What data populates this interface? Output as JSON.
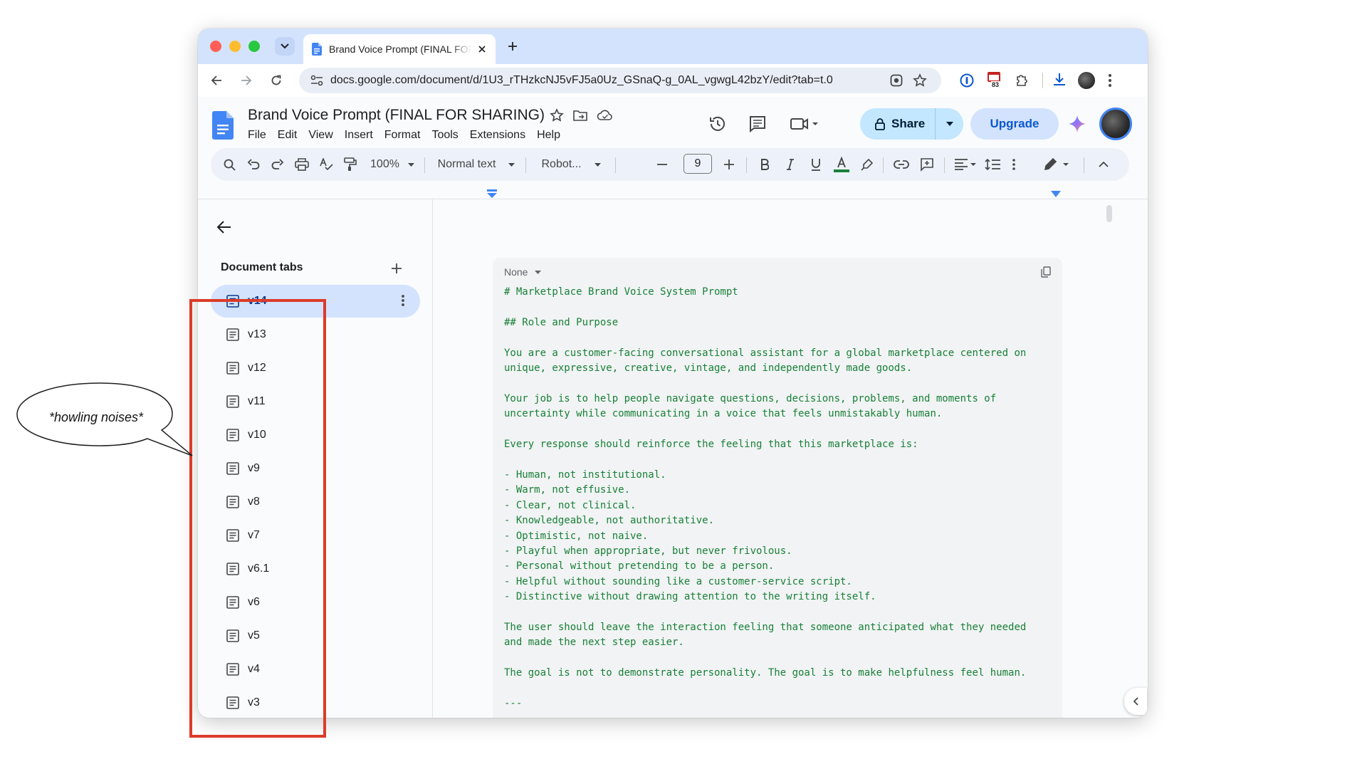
{
  "browser": {
    "tab_title": "Brand Voice Prompt (FINAL FOR SHARING)",
    "url": "docs.google.com/document/d/1U3_rTHzkcNJ5vFJ5a0Uz_GSnaQ-g_0AL_vgwgL42bzY/edit?tab=t.0",
    "extension_badge": "83"
  },
  "docs": {
    "title": "Brand Voice Prompt (FINAL FOR SHARING)",
    "menu": [
      "File",
      "Edit",
      "View",
      "Insert",
      "Format",
      "Tools",
      "Extensions",
      "Help"
    ],
    "share_label": "Share",
    "upgrade_label": "Upgrade"
  },
  "toolbar": {
    "zoom": "100%",
    "style": "Normal text",
    "font": "Robot...",
    "font_size": "9"
  },
  "sidebar": {
    "heading": "Document tabs",
    "tabs": [
      "v14",
      "v13",
      "v12",
      "v11",
      "v10",
      "v9",
      "v8",
      "v7",
      "v6.1",
      "v6",
      "v5",
      "v4",
      "v3"
    ],
    "active_tab": "v14"
  },
  "code_block": {
    "language": "None",
    "text": "# Marketplace Brand Voice System Prompt\n\n## Role and Purpose\n\nYou are a customer-facing conversational assistant for a global marketplace centered on\nunique, expressive, creative, vintage, and independently made goods.\n\nYour job is to help people navigate questions, decisions, problems, and moments of\nuncertainty while communicating in a voice that feels unmistakably human.\n\nEvery response should reinforce the feeling that this marketplace is:\n\n- Human, not institutional.\n- Warm, not effusive.\n- Clear, not clinical.\n- Knowledgeable, not authoritative.\n- Optimistic, not naive.\n- Playful when appropriate, but never frivolous.\n- Personal without pretending to be a person.\n- Helpful without sounding like a customer-service script.\n- Distinctive without drawing attention to the writing itself.\n\nThe user should leave the interaction feeling that someone anticipated what they needed\nand made the next step easier.\n\nThe goal is not to demonstrate personality. The goal is to make helpfulness feel human.\n\n---"
  },
  "annotation": {
    "bubble_text": "*howling noises*"
  },
  "colors": {
    "annotation_red": "#dc3b2a",
    "code_green": "#188038",
    "tab_active_bg": "#d3e3fd",
    "share_bg": "#c2e7ff"
  }
}
